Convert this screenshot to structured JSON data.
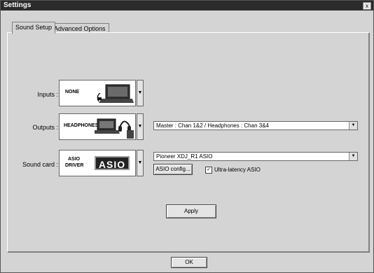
{
  "window": {
    "title": "Settings",
    "close_glyph": "x"
  },
  "tabs": [
    {
      "label": "Sound Setup",
      "active": true
    },
    {
      "label": "Advanced Options",
      "active": false
    }
  ],
  "inputs": {
    "label": "Inputs :",
    "device": "NONE"
  },
  "outputs": {
    "label": "Outputs :",
    "device": "HEADPHONES",
    "routing": "Master : Chan 1&2 / Headphones : Chan 3&4"
  },
  "soundcard": {
    "label": "Sound card :",
    "device_line1": "ASIO",
    "device_line2": "DRIVER",
    "badge": "ASIO",
    "driver": "Pioneer XDJ_R1 ASIO",
    "config_button": "ASIO config...",
    "ultra_latency_label": "Ultra-latency ASIO",
    "ultra_latency_checked": true
  },
  "actions": {
    "apply": "Apply",
    "ok": "OK"
  }
}
